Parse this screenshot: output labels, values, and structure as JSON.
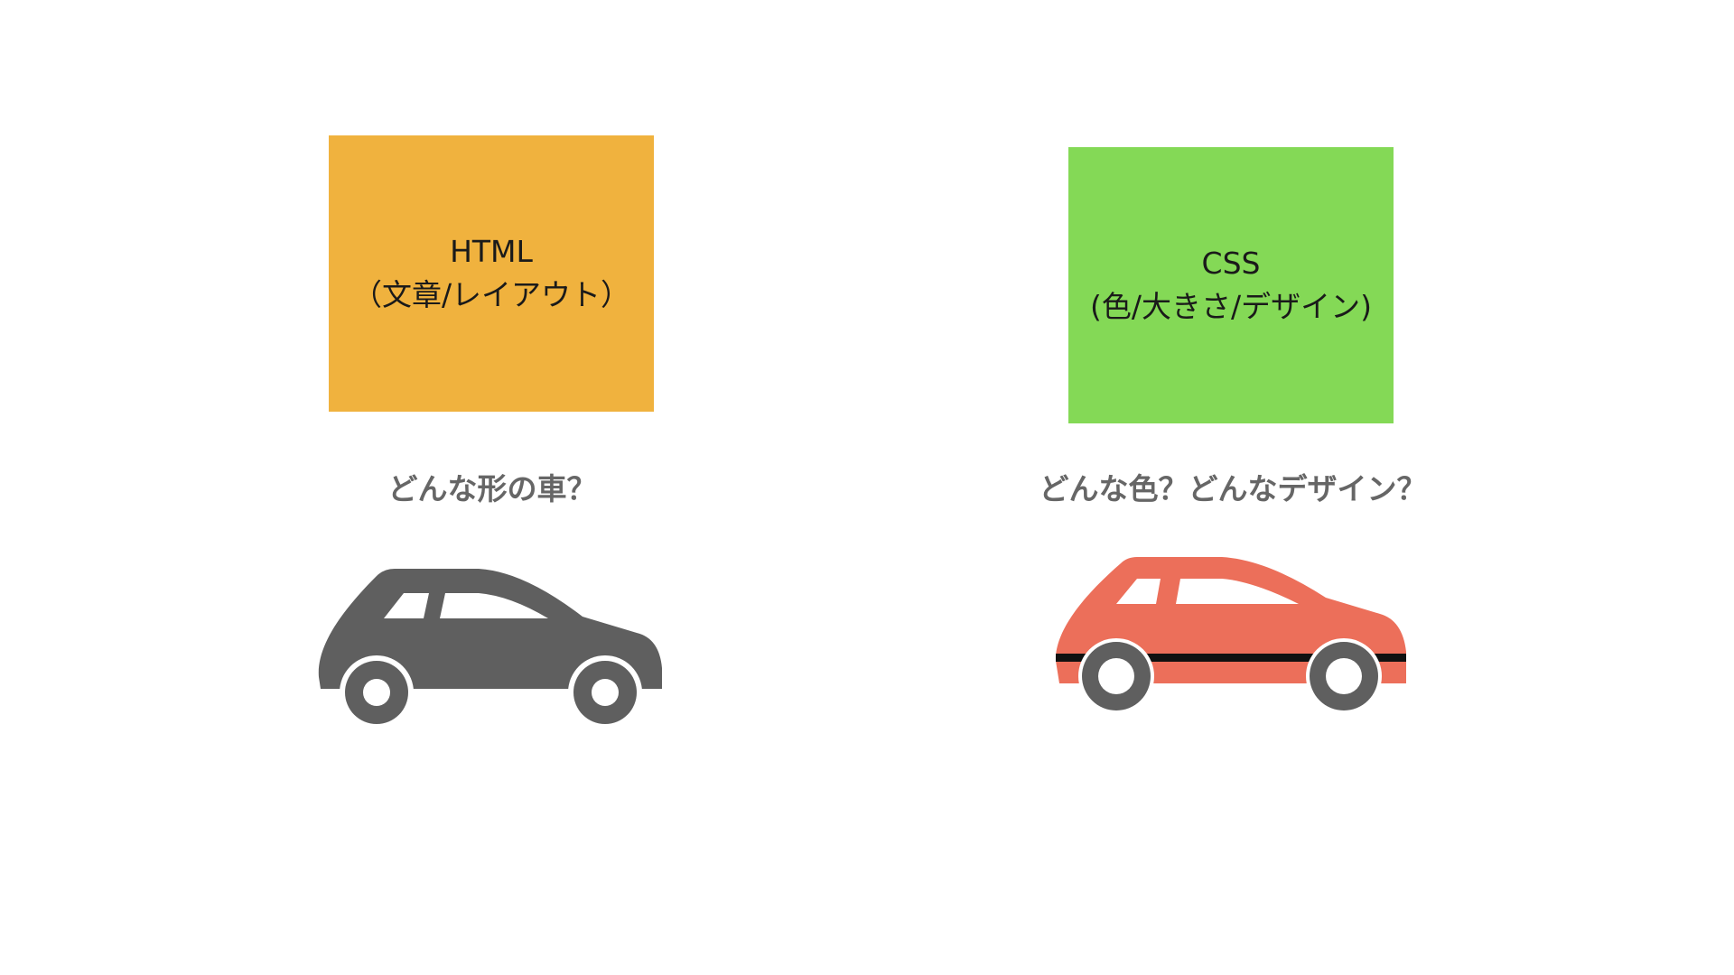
{
  "html_concept": {
    "title": "HTML",
    "subtitle": "（文章/レイアウト）",
    "box_color": "#F0B23E",
    "question": "どんな形の車？",
    "car_color": "#5F5F5F",
    "car_icon": "car-silhouette-icon"
  },
  "css_concept": {
    "title": "CSS",
    "subtitle": "(色/大きさ/デザイン)",
    "box_color": "#84D956",
    "question": "どんな色？どんなデザイン？",
    "car_color": "#EC6F5A",
    "car_stripe_color": "#111111",
    "car_icon": "styled-car-icon"
  },
  "colors": {
    "question_text": "#666666",
    "wheel_dark": "#5F5F5F",
    "window": "#FFFFFF"
  }
}
